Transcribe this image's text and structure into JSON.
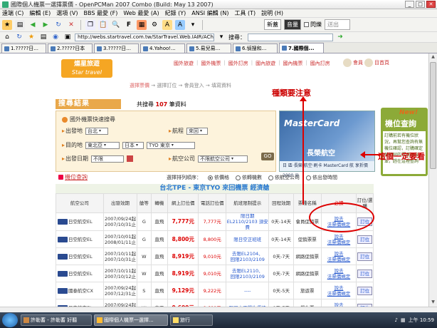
{
  "window": {
    "title": "國際個人機票一選擇票價 - OpenPCMan 2007 Combo (Build: May 13 2007)"
  },
  "menu": [
    "遠端 (C)",
    "編輯 (E)",
    "選項 (V)",
    "BBS 最愛 (F)",
    "Web 最愛 (A)",
    "紀錄 (Y)",
    "ANSI 編輯 (N)",
    "工具 (T)",
    "說明 (H)"
  ],
  "toolbar": {
    "new_label": "新蓋",
    "sound_label": "音量",
    "flash_label": "閃爍",
    "send_label": "送出"
  },
  "address": {
    "url": "http://webs.startravel.com.tw/StarTravel.Web.IAIR/AChoiceTicl",
    "search_label": "搜尋："
  },
  "tabs": [
    {
      "label": "1.?????日..."
    },
    {
      "label": "2.?????日本"
    },
    {
      "label": "3.?????日..."
    },
    {
      "label": "4.Yahoo!..."
    },
    {
      "label": "5.易兒易..."
    },
    {
      "label": "6.偵搜和..."
    },
    {
      "label": "7.國際個..."
    }
  ],
  "site": {
    "logo_cn": "燦星旅遊",
    "logo_en": "Star travel",
    "topnav": [
      "國外旅遊",
      "國外機票",
      "國外訂房",
      "國內旅遊",
      "國內機票",
      "國內訂房"
    ],
    "topicons": [
      "會員",
      "目首頁"
    ],
    "steps": {
      "active": "選擇票價",
      "rest": "→ 選擇訂位 → 會員登入 → 填寫資料"
    },
    "result_title": "搜尋結果",
    "result_count_pre": "共搜尋",
    "result_count": "107",
    "result_count_post": "筆資料"
  },
  "annotation": {
    "top": "種類要注意",
    "right": "這個一定要看"
  },
  "search": {
    "heading": "國外機票快速搜尋",
    "depart_label": "出發地",
    "depart_value": "台北",
    "trip_label": "航程",
    "trip_value": "來回",
    "dest_label": "目的地",
    "dest_region": "東北亞",
    "dest_country": "日本",
    "dest_city": "TYO 東京",
    "date_label": "出發日期",
    "date_value": "不限",
    "airline_label": "航空公司",
    "airline_value": "不限航空公司",
    "go_label": "GO"
  },
  "ad": {
    "title": "MasterCard",
    "subtitle": "長榮航空",
    "strip": "日 區·長榮 航空·刷卡 MasterCard 航 享折價 2000 元"
  },
  "side": {
    "new_label": "New!",
    "title": "機位查詢",
    "body": "訂購前若有機位狀況，再幫您查詢有無機位確認，訂購確定後相同的票價再出並，趕在這裡查詢"
  },
  "price_link": "機位查詢",
  "sort": {
    "label": "選擇排列順序：",
    "options": [
      {
        "label": "依價格",
        "checked": true
      },
      {
        "label": "依轉機數",
        "checked": false
      },
      {
        "label": "依航空公司",
        "checked": false
      },
      {
        "label": "依出發時間",
        "checked": false
      }
    ]
  },
  "table_title": "台北TPE - 東京TYO 來回機票 經濟艙",
  "columns": [
    "航空公司",
    "出發效期",
    "艙等",
    "轉機",
    "網上訂位價",
    "電話訂位價",
    "航班限制提示",
    "回程效期",
    "票種名稱",
    "必讀",
    "訂位/選購"
  ],
  "rows": [
    {
      "airline": "日空航空EL",
      "validity": "2007/09/24起\n2007/10/31止",
      "cls": "G",
      "transfer": "直飛",
      "web": "7,777元",
      "phone": "7,777元",
      "limit": "限日期\nEL2110/2103 須安費",
      "ret": "0天-14天",
      "ticket": "會員促銷票",
      "read": "說去\n法票價規定",
      "book": "訂位"
    },
    {
      "airline": "日空航空EL",
      "validity": "2007/10/01起\n2008/01/11止",
      "cls": "G",
      "transfer": "直飛",
      "web": "8,800元",
      "phone": "8,800元",
      "limit": "限日空正班班",
      "ret": "0天-14天",
      "ticket": "促銷票票",
      "read": "說去\n法票價規定",
      "book": "訂位"
    },
    {
      "airline": "日空航空EL",
      "validity": "2007/10/11起\n2007/10/31止",
      "cls": "W",
      "transfer": "直飛",
      "web": "8,919元",
      "phone": "9,010元",
      "limit": "去限EL2104、\n回限2103/2109",
      "ret": "0天-7天",
      "ticket": "網路促銷票",
      "read": "說去\n法票價規定",
      "book": "訂位"
    },
    {
      "airline": "日空航空EL",
      "validity": "2007/10/11起\n2007/10/12止",
      "cls": "W",
      "transfer": "直飛",
      "web": "8,919元",
      "phone": "9,010元",
      "limit": "去限EL2110、\n回限2103/2109",
      "ret": "0天-7天",
      "ticket": "網路促銷票",
      "read": "說去\n法票價規定",
      "book": "訂位"
    },
    {
      "airline": "國泰航空CX",
      "validity": "2007/09/24起\n2007/12/31止",
      "cls": "S",
      "transfer": "直飛",
      "web": "9,129元",
      "phone": "9,222元",
      "limit": "----",
      "ret": "0天-5天",
      "ticket": "旅遊票",
      "read": "說去\n法票價規定",
      "book": "訂位"
    },
    {
      "airline": "日空航空EL",
      "validity": "2007/09/24起\n2007/10/31止",
      "cls": "W",
      "transfer": "直飛",
      "web": "9,600元",
      "phone": "9,600元",
      "limit": "限日文不學生優待",
      "ret": "0天-7天",
      "ticket": "學生票",
      "read": "說去\n法票價規定",
      "book": "訂位"
    }
  ],
  "taskbar": {
    "tasks": [
      "許勒蓄 - 許勒蓄 好聽",
      "國際個人機票一選擇...",
      "旅行"
    ],
    "time": "上午 10:59"
  }
}
